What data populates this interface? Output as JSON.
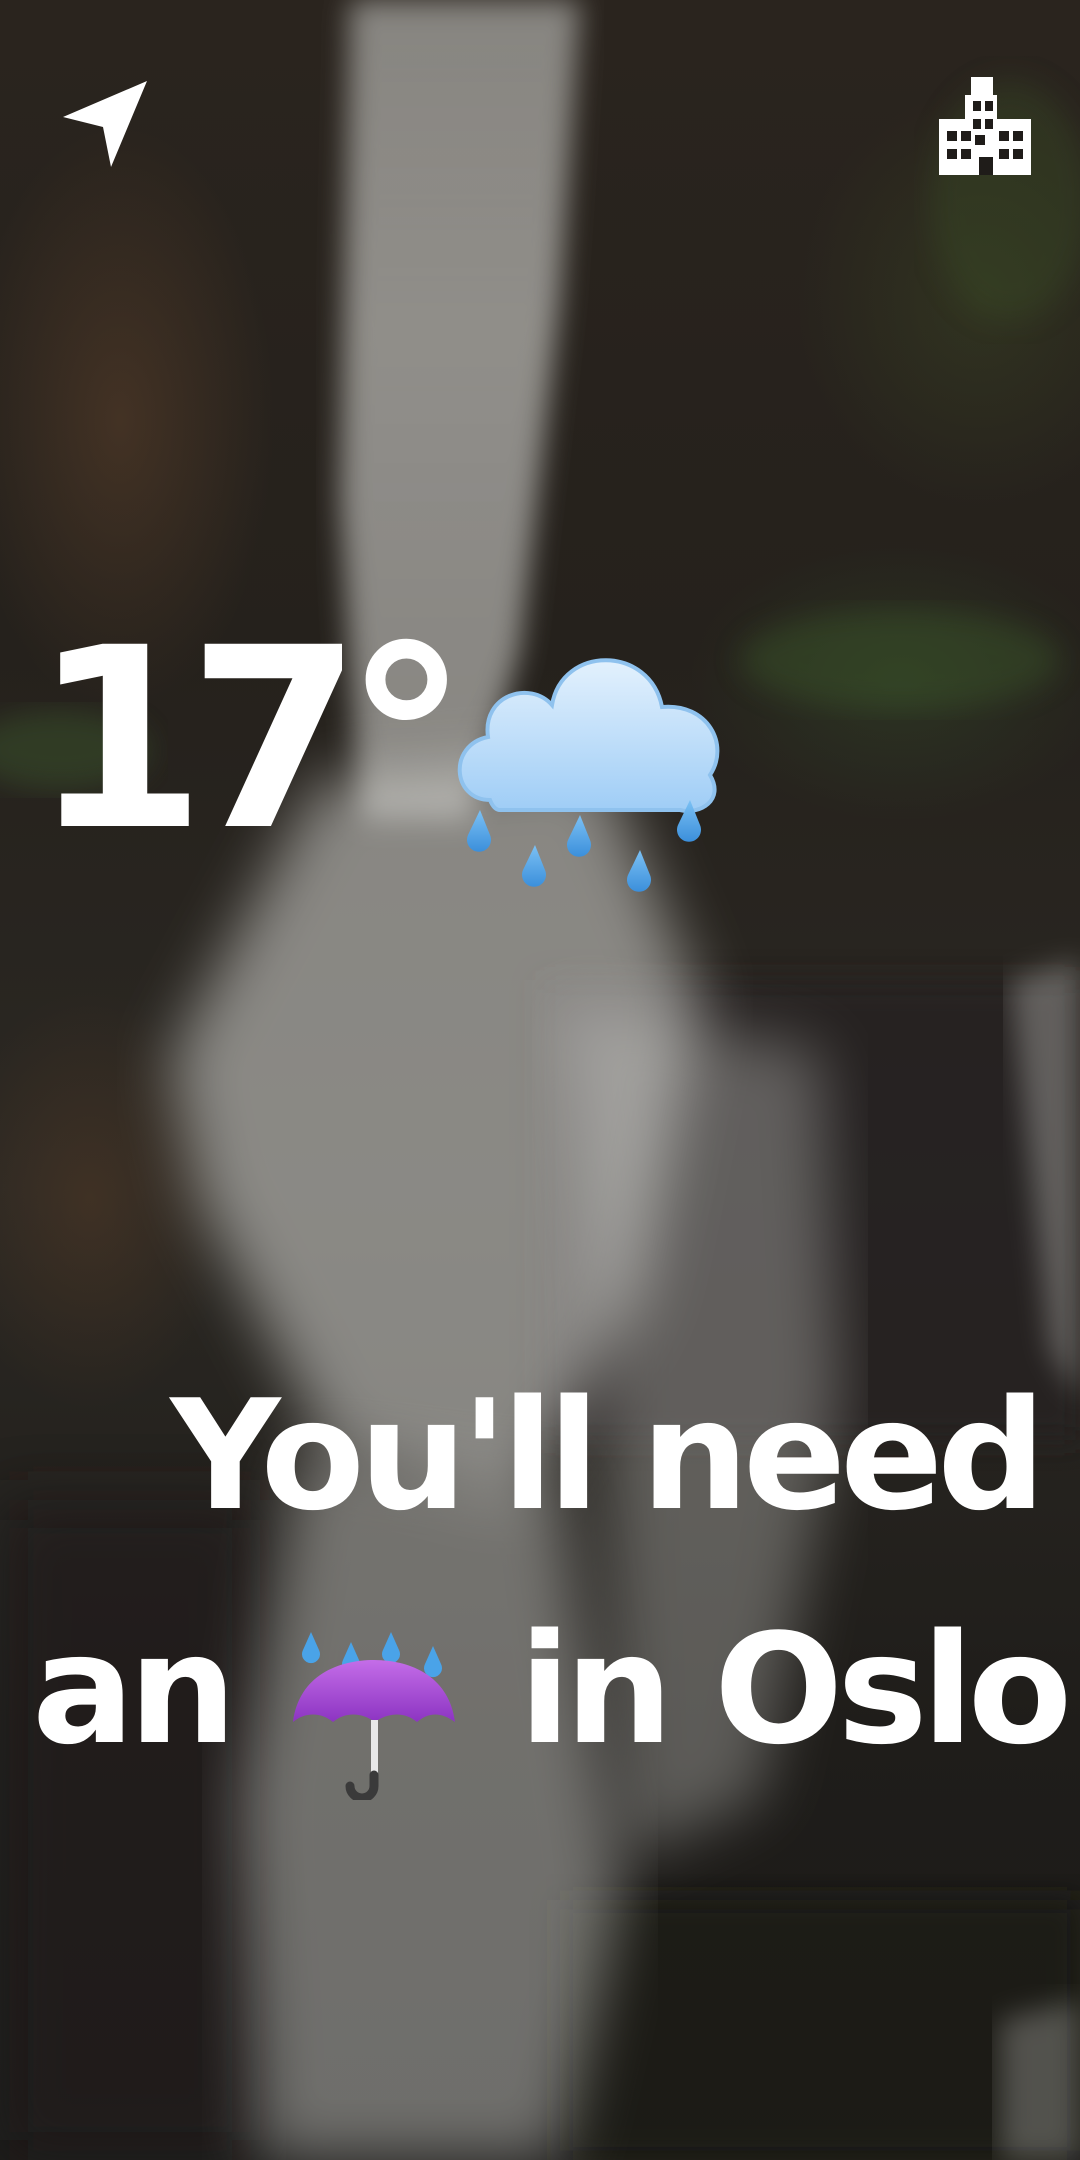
{
  "weather": {
    "temperature": "17°",
    "condition_icon": "rain-cloud-icon",
    "message_line1": "You'll need",
    "message_line2_prefix": "an",
    "message_line2_icon": "umbrella-with-rain-icon",
    "message_line2_suffix": "in Oslo"
  },
  "toolbar": {
    "locate_icon": "navigation-arrow-icon",
    "city_icon": "city-building-icon"
  },
  "colors": {
    "text": "#ffffff",
    "cloud": "#bfe0fb",
    "raindrop": "#4aa3e8",
    "umbrella": "#a64fd3"
  }
}
